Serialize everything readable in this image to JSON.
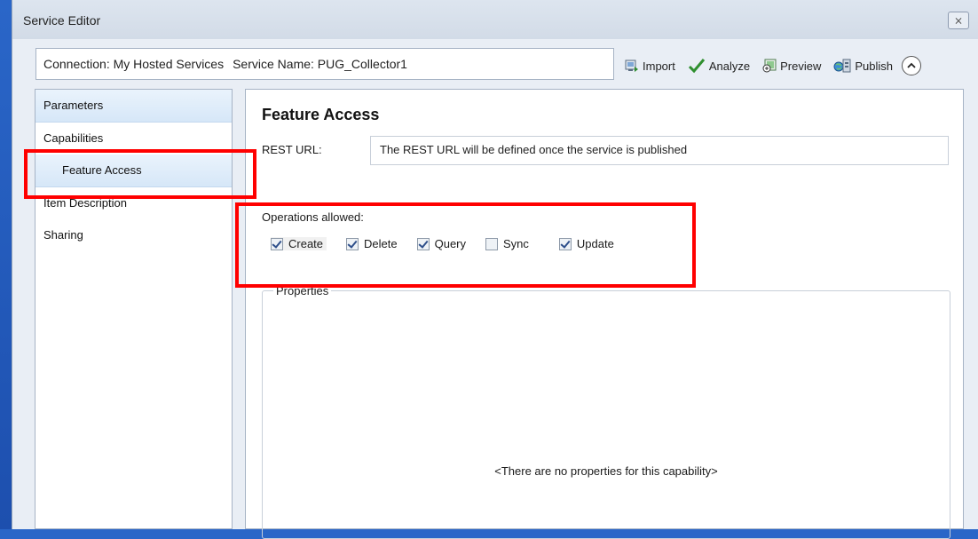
{
  "window": {
    "title": "Service Editor",
    "close_glyph": "⨯"
  },
  "connection": {
    "connection_text": "Connection: My Hosted Services",
    "service_text": "Service Name: PUG_Collector1"
  },
  "toolbar": {
    "import_label": "Import",
    "analyze_label": "Analyze",
    "preview_label": "Preview",
    "publish_label": "Publish"
  },
  "sidebar": {
    "items": [
      {
        "label": "Parameters"
      },
      {
        "label": "Capabilities"
      },
      {
        "label": "Feature Access"
      },
      {
        "label": "Item Description"
      },
      {
        "label": "Sharing"
      }
    ],
    "selected": "Feature Access"
  },
  "main": {
    "heading": "Feature Access",
    "rest_label": "REST URL:",
    "rest_value": "The REST URL will be defined once the service is published",
    "ops_label": "Operations allowed:",
    "operations": [
      {
        "label": "Create",
        "checked": true
      },
      {
        "label": "Delete",
        "checked": true
      },
      {
        "label": "Query",
        "checked": true
      },
      {
        "label": "Sync",
        "checked": false
      },
      {
        "label": "Update",
        "checked": true
      }
    ],
    "properties_legend": "Properties",
    "properties_empty": "<There are no properties for this capability>"
  },
  "colors": {
    "highlight": "#ff0000",
    "desktop": "#2a66c8"
  }
}
